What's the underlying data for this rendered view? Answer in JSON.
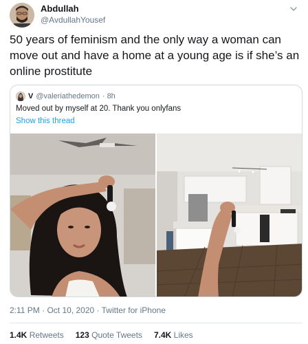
{
  "author": {
    "display_name": "Abdullah",
    "handle": "@AvdullahYousef"
  },
  "tweet": {
    "text": "50 years of feminism and the only way a woman can move out and have a home at a young age is if she’s an online prostitute"
  },
  "quoted_tweet": {
    "display_name": "V",
    "handle": "@valeriathedemon",
    "time": "· 8h",
    "text": "Moved out by myself at 20. Thank you onlyfans",
    "show_thread": "Show this thread"
  },
  "meta": {
    "timestamp": "2:11 PM · Oct 10, 2020 · Twitter for iPhone"
  },
  "stats": {
    "retweets_count": "1.4K",
    "retweets_label": "Retweets",
    "quotes_count": "123",
    "quotes_label": "Quote Tweets",
    "likes_count": "7.4K",
    "likes_label": "Likes"
  },
  "colors": {
    "link": "#1da1f2",
    "secondary_text": "#657786",
    "border": "#cfd9de"
  },
  "icons": {
    "more": "chevron-down-icon"
  }
}
